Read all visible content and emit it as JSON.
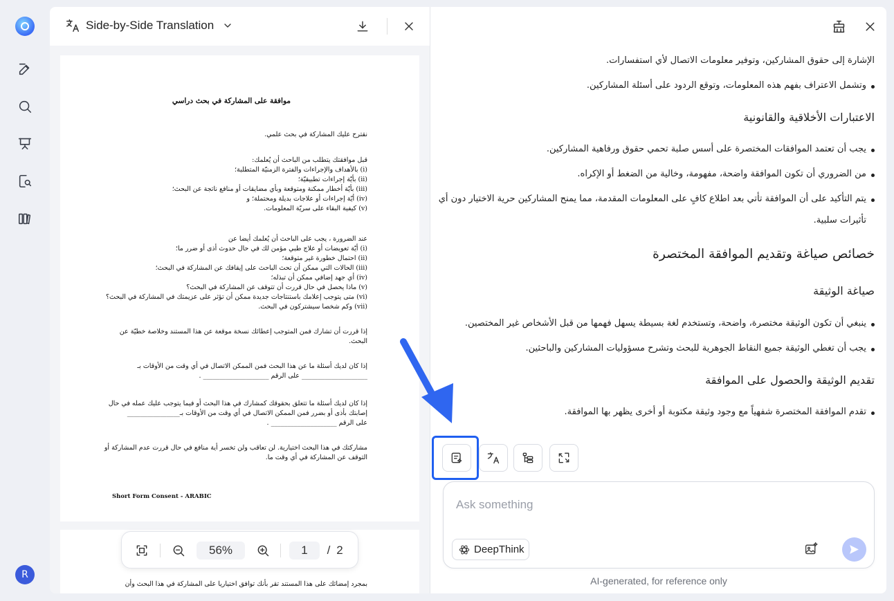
{
  "rail": {
    "avatar_initial": "R"
  },
  "doc": {
    "title": "Side-by-Side Translation",
    "page_lines": [
      "موافقة على المشاركة في بحث دراسي",
      "نقترح عليك المشاركة في بحث علمي.",
      "قبل موافقتك يتطلب من الباحث أن يُعلمك:",
      "(i) بالأهداف والإجراءات والفترة الزمنيّة المتطلبة؛",
      "(ii) بأيّة إجراءات تطبيقيّة؛",
      "(iii) بأيّة أخطار ممكنة ومتوقعة وبأي مضايقات أو منافع ناتجة عن البحث؛",
      "(iv) أيّة إجراءات أو علاجات بديلة ومحتملة؛ و",
      "(v) كيفية البقاء على سريّة المعلومات.",
      "عند الضرورة ، يجب على الباحث أن يُعلمك أيضا عن",
      "(i) أيّة تعويضات أو علاج طبي مؤمن لك في حال حدوث أذى أو ضرر ما؛",
      "(ii) احتمال خطورة غير متوقعة؛",
      "(iii) الحالات التي ممكن أن تحث الباحث على إيقافك عن المشاركة في البحث؛",
      "(iv) أي جهد إضافي ممكن أن تبذله؛",
      "(v) ماذا يحصل في حال قررت أن تتوقف عن المشاركة في البحث؟",
      "(vi) متى يتوجب إعلامك باستنتاجات جديدة ممكن أن تؤثر على عزيمتك في المشاركة في البحث؟",
      "(vii) وكم شخصا سيشتركون في البحث.",
      "إذا قررت أن تشارك فمن المتوجب إعطائك نسخة موقعة عن هذا المستند وخلاصة خطيّة عن",
      "البحث.",
      "إذا كان لديك أسئلة ما عن هذا البحث فمن الممكن الاتصال في أي وقت من الأوقات بـ",
      "____________________ على الرقم ____________________ .",
      "إذا كان لديك أسئلة ما تتعلق بحقوقك كمشارك في هذا البحث أو فيما يتوجب عليك عمله في حال",
      "إصابتك بأذى أو بضرر فمن الممكن الاتصال في أي وقت من الأوقات بـ________________",
      "على الرقم ____________________ .",
      "مشاركتك في هذا البحث اختيارية. لن تعاقب ولن تخسر أية منافع في حال قررت عدم المشاركة أو",
      "التوقف عن المشاركة في أي وقت ما.",
      "Short Form Consent - ARABIC",
      "بمجرد إمضائك على هذا المستند تقر بأنك توافق اختياريا على المشاركة في هذا البحث وأن"
    ]
  },
  "zoom": {
    "level": "56%",
    "current_page": "1",
    "separator": "/",
    "total_pages": "2"
  },
  "chat": {
    "lines": [
      "الإشارة إلى حقوق المشاركين، وتوفير معلومات الاتصال لأي استفسارات.",
      "وتشمل الاعتراف بفهم هذه المعلومات، وتوقع الردود على أسئلة المشاركين.",
      "الاعتبارات الأخلاقية والقانونية",
      "يجب أن تعتمد الموافقات المختصرة على أسس صلبة تحمي حقوق ورفاهية المشاركين.",
      "من الضروري أن تكون الموافقة واضحة، مفهومة، وخالية من الضغط أو الإكراه.",
      "يتم التأكيد على أن الموافقة تأتي بعد اطلاع كافٍ على المعلومات المقدمة، مما يمنح المشاركين حرية الاختيار دون أي",
      "تأثيرات سلبية.",
      "خصائص صياغة وتقديم الموافقة المختصرة",
      "صياغة الوثيقة",
      "ينبغي أن تكون الوثيقة مختصرة، واضحة، وتستخدم لغة بسيطة يسهل فهمها من قبل الأشخاص غير المختصين.",
      "يجب أن تغطي الوثيقة جميع النقاط الجوهرية للبحث وتشرح مسؤوليات المشاركين والباحثين.",
      "تقديم الوثيقة والحصول على الموافقة",
      "تقدم الموافقة المختصرة شفهياً مع وجود وثيقة مكتوبة أو أخرى يظهر بها الموافقة."
    ],
    "ask_placeholder": "Ask something",
    "deepthink_label": "DeepThink",
    "disclaimer": "AI-generated, for reference only"
  }
}
